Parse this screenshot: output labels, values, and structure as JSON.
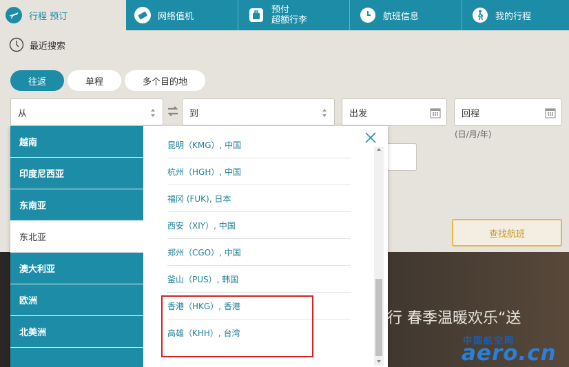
{
  "nav": {
    "tabs": [
      {
        "label": "行程 预订",
        "icon": "plane-icon",
        "active": true
      },
      {
        "label": "网络值机",
        "icon": "ticket-icon"
      },
      {
        "label_line1": "预付",
        "label_line2": "超额行李",
        "icon": "luggage-icon"
      },
      {
        "label": "航班信息",
        "icon": "clock-icon"
      },
      {
        "label": "我的行程",
        "icon": "traveler-icon"
      }
    ]
  },
  "recent": {
    "label": "最近搜索",
    "icon": "clock-icon"
  },
  "trip_types": [
    "往返",
    "单程",
    "多个目的地"
  ],
  "fields": {
    "from": "从",
    "to": "到",
    "depart": "出发",
    "return": "回程",
    "date_hint": "(日/月/年)"
  },
  "search_button": "查找航班",
  "regions": [
    "越南",
    "印度尼西亚",
    "东南亚",
    "东北亚",
    "澳大利亚",
    "欧洲",
    "北美洲"
  ],
  "active_region": "东北亚",
  "cities": [
    "昆明（KMG）, 中国",
    "杭州（HGH）, 中国",
    "福冈 (FUK), 日本",
    "西安（XIY）, 中国",
    "郑州（CGO）, 中国",
    "釜山（PUS）, 韩国",
    "香港（HKG）, 香港",
    "高雄（KHH）, 台湾"
  ],
  "banner": {
    "text": "行 春季温暖欢乐“送",
    "watermark_cn": "中国航空网",
    "watermark_en": "aero.cn"
  },
  "colors": {
    "brand": "#1c8ca7",
    "highlight": "#d62020",
    "search_border": "#e5b84a"
  }
}
